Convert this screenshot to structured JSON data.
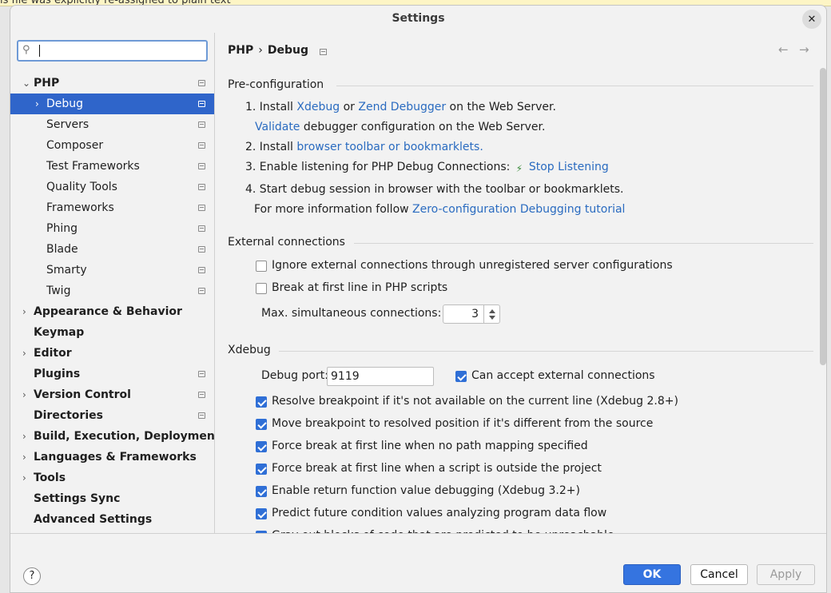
{
  "background": {
    "text": "is file was explicitly re-assigned to plain text"
  },
  "dialog": {
    "title": "Settings",
    "close_glyph": "✕"
  },
  "search": {
    "value": ""
  },
  "sidebar": {
    "items": [
      {
        "label": "PHP",
        "bold": true,
        "expanded": true,
        "level": 0,
        "has_arrow": true,
        "project": true
      },
      {
        "label": "Debug",
        "bold": false,
        "selected": true,
        "level": 1,
        "has_arrow": true,
        "project": true
      },
      {
        "label": "Servers",
        "level": 1,
        "project": true
      },
      {
        "label": "Composer",
        "level": 1,
        "project": true
      },
      {
        "label": "Test Frameworks",
        "level": 1,
        "project": true
      },
      {
        "label": "Quality Tools",
        "level": 1,
        "project": true
      },
      {
        "label": "Frameworks",
        "level": 1,
        "project": true
      },
      {
        "label": "Phing",
        "level": 1,
        "project": true
      },
      {
        "label": "Blade",
        "level": 1,
        "project": true
      },
      {
        "label": "Smarty",
        "level": 1,
        "project": true
      },
      {
        "label": "Twig",
        "level": 1,
        "project": true
      },
      {
        "label": "Appearance & Behavior",
        "bold": true,
        "level": 0,
        "has_arrow": true
      },
      {
        "label": "Keymap",
        "bold": true,
        "level": 0
      },
      {
        "label": "Editor",
        "bold": true,
        "level": 0,
        "has_arrow": true
      },
      {
        "label": "Plugins",
        "bold": true,
        "level": 0,
        "project": true
      },
      {
        "label": "Version Control",
        "bold": true,
        "level": 0,
        "has_arrow": true,
        "project": true
      },
      {
        "label": "Directories",
        "bold": true,
        "level": 0,
        "project": true
      },
      {
        "label": "Build, Execution, Deployment",
        "bold": true,
        "level": 0,
        "has_arrow": true
      },
      {
        "label": "Languages & Frameworks",
        "bold": true,
        "level": 0,
        "has_arrow": true
      },
      {
        "label": "Tools",
        "bold": true,
        "level": 0,
        "has_arrow": true
      },
      {
        "label": "Settings Sync",
        "bold": true,
        "level": 0
      },
      {
        "label": "Advanced Settings",
        "bold": true,
        "level": 0
      }
    ]
  },
  "breadcrumb": {
    "parent": "PHP",
    "separator": "›",
    "current": "Debug"
  },
  "nav": {
    "back": "←",
    "forward": "→"
  },
  "preconfig": {
    "title": "Pre-configuration",
    "step1_prefix": "1. Install ",
    "step1_link1": "Xdebug",
    "step1_or": " or ",
    "step1_link2": "Zend Debugger",
    "step1_suffix": " on the Web Server.",
    "validate_link": "Validate",
    "validate_suffix": " debugger configuration on the Web Server.",
    "step2_prefix": "2. Install ",
    "step2_link": "browser toolbar or bookmarklets.",
    "step3_prefix": "3. Enable listening for PHP Debug Connections: ",
    "step3_link": "Stop Listening",
    "step4": "4. Start debug session in browser with the toolbar or bookmarklets.",
    "more_prefix": "For more information follow ",
    "more_link": "Zero-configuration Debugging tutorial"
  },
  "external": {
    "title": "External connections",
    "ignore_label": "Ignore external connections through unregistered server configurations",
    "ignore_checked": false,
    "break_label": "Break at first line in PHP scripts",
    "break_checked": false,
    "max_label": "Max. simultaneous connections:",
    "max_value": "3"
  },
  "xdebug": {
    "title": "Xdebug",
    "port_label": "Debug port:",
    "port_value": "9119",
    "accept_label": "Can accept external connections",
    "options": [
      "Resolve breakpoint if it's not available on the current line (Xdebug 2.8+)",
      "Move breakpoint to resolved position if it's different from the source",
      "Force break at first line when no path mapping specified",
      "Force break at first line when a script is outside the project",
      "Enable return function value debugging (Xdebug 3.2+)",
      "Predict future condition values analyzing program data flow",
      "Gray out blocks of code that are predicted to be unreachable"
    ]
  },
  "footer": {
    "help": "?",
    "ok": "OK",
    "cancel": "Cancel",
    "apply": "Apply"
  },
  "colors": {
    "accent": "#2f65ca",
    "link": "#2a6bc0",
    "ok_button": "#3574e0"
  }
}
